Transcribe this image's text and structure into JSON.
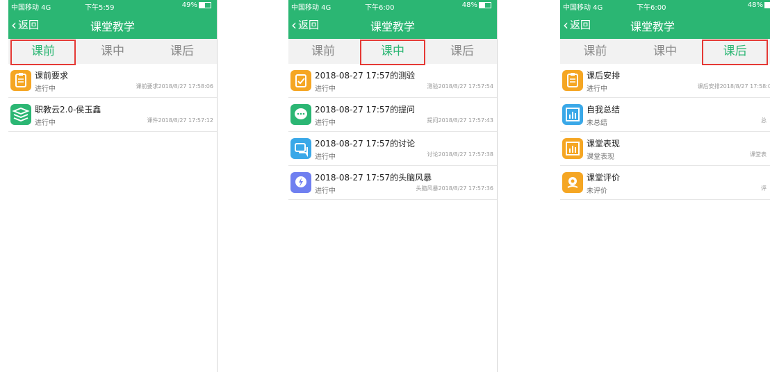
{
  "status_bars": [
    {
      "carrier": "中国移动  4G",
      "time": "下午5:59",
      "battery": "49%"
    },
    {
      "carrier": "中国移动  4G",
      "time": "下午6:00",
      "battery": "48%"
    },
    {
      "carrier": "中国移动  4G",
      "time": "下午6:00",
      "battery": "48%"
    }
  ],
  "nav": {
    "back_label": "返回",
    "title": "课堂教学"
  },
  "tabs": [
    "课前",
    "课中",
    "课后"
  ],
  "colors": {
    "brand": "#2bb673",
    "highlight": "#e53935"
  },
  "screens": [
    {
      "active_tab": "课前",
      "items": [
        {
          "icon": "clipboard-icon",
          "name": "课前要求",
          "status": "进行中",
          "info": "课前要求2018/8/27 17:58:06"
        },
        {
          "icon": "book-stack-icon",
          "name": "职教云2.0-侯玉鑫",
          "status": "进行中",
          "info": "课件2018/8/27 17:57:12"
        }
      ]
    },
    {
      "active_tab": "课中",
      "items": [
        {
          "icon": "quiz-icon",
          "name": "2018-08-27 17:57的测验",
          "status": "进行中",
          "info": "测验2018/8/27 17:57:54"
        },
        {
          "icon": "chat-bubble-icon",
          "name": "2018-08-27 17:57的提问",
          "status": "进行中",
          "info": "提问2018/8/27 17:57:43"
        },
        {
          "icon": "discussion-icon",
          "name": "2018-08-27 17:57的讨论",
          "status": "进行中",
          "info": "讨论2018/8/27 17:57:38"
        },
        {
          "icon": "brainstorm-icon",
          "name": "2018-08-27 17:57的头脑风暴",
          "status": "进行中",
          "info": "头脑风暴2018/8/27 17:57:36"
        }
      ]
    },
    {
      "active_tab": "课后",
      "items": [
        {
          "icon": "clipboard-icon",
          "name": "课后安排",
          "status": "进行中",
          "info": "课后安排2018/8/27 17:58:0"
        },
        {
          "icon": "bar-chart-icon",
          "name": "自我总结",
          "status": "未总结",
          "info": "总"
        },
        {
          "icon": "bar-chart-icon",
          "name": "课堂表现",
          "status": "课堂表现",
          "info": "课堂表"
        },
        {
          "icon": "flower-icon",
          "name": "课堂评价",
          "status": "未评价",
          "info": "评"
        }
      ]
    }
  ]
}
